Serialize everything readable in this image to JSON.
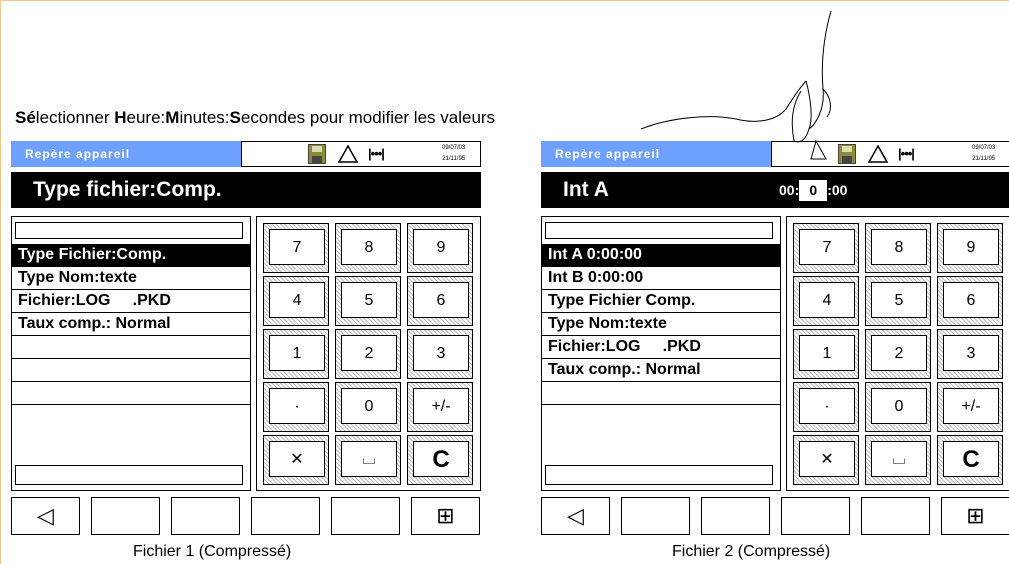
{
  "instruction": {
    "parts": [
      {
        "text": "Sé",
        "bold": true
      },
      {
        "text": "lectionner ",
        "bold": false
      },
      {
        "text": "H",
        "bold": true
      },
      {
        "text": "eure:",
        "bold": false
      },
      {
        "text": "M",
        "bold": true
      },
      {
        "text": "inutes:",
        "bold": false
      },
      {
        "text": "S",
        "bold": true
      },
      {
        "text": "econdes pour modifier les valeurs",
        "bold": false
      }
    ]
  },
  "devices": [
    {
      "header_label": "Repère   appareil",
      "datetime": [
        "09/07/03",
        "21/11/95"
      ],
      "icons": [
        "disk-icon",
        "warning-icon",
        "signal-icon"
      ],
      "title": "Type  fichier:Comp.",
      "time_label": "",
      "time_value": "",
      "list": [
        {
          "label": "Type Fichier:Comp.",
          "selected": true
        },
        {
          "label": "Type Nom:texte",
          "selected": false
        },
        {
          "label": "Fichier:LOG     .PKD",
          "selected": false
        },
        {
          "label": "Taux comp.: Normal",
          "selected": false
        },
        {
          "label": "",
          "selected": false
        },
        {
          "label": "",
          "selected": false
        },
        {
          "label": "",
          "selected": false
        }
      ],
      "caption": "Fichier 1 (Compressé)"
    },
    {
      "header_label": "Repère   appareil",
      "datetime": [
        "09/07/03",
        "21/11/95"
      ],
      "icons": [
        "disk-icon",
        "warning-icon",
        "signal-icon"
      ],
      "title": "Int A",
      "time_label": "00:",
      "time_value": "0",
      "time_suffix": ":00",
      "list": [
        {
          "label": "Int A 0:00:00",
          "selected": true
        },
        {
          "label": "Int B 0:00:00",
          "selected": false
        },
        {
          "label": "Type Fichier Comp.",
          "selected": false
        },
        {
          "label": "Type Nom:texte",
          "selected": false
        },
        {
          "label": "Fichier:LOG     .PKD",
          "selected": false
        },
        {
          "label": "Taux comp.: Normal",
          "selected": false
        },
        {
          "label": "",
          "selected": false
        }
      ],
      "caption": "Fichier 2 (Compressé)"
    }
  ],
  "keypad": [
    [
      "7",
      "8",
      "9"
    ],
    [
      "4",
      "5",
      "6"
    ],
    [
      "1",
      "2",
      "3"
    ],
    [
      "·",
      "0",
      "+/-"
    ],
    [
      "✕",
      "⌴",
      "C"
    ]
  ],
  "bottom_buttons": [
    "◁",
    "",
    "",
    "",
    "",
    "⊞"
  ]
}
